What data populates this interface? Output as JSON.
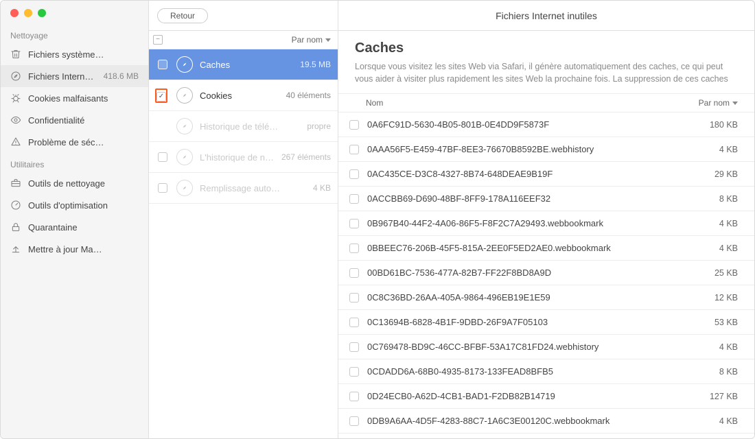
{
  "window_title": "Fichiers Internet inutiles",
  "toolbar": {
    "back_label": "Retour"
  },
  "sidebar": {
    "sections": [
      {
        "label": "Nettoyage",
        "items": [
          {
            "icon": "trash",
            "name": "fichiers-systeme",
            "label": "Fichiers système…",
            "meta": ""
          },
          {
            "icon": "compass",
            "name": "fichiers-internet",
            "label": "Fichiers Internet i…",
            "meta": "418.6 MB",
            "selected": true
          },
          {
            "icon": "bug",
            "name": "cookies-malfaisants",
            "label": "Cookies malfaisants",
            "meta": ""
          },
          {
            "icon": "eye",
            "name": "confidentialite",
            "label": "Confidentialité",
            "meta": ""
          },
          {
            "icon": "warning",
            "name": "probleme-securite",
            "label": "Problème de séc…",
            "meta": ""
          }
        ]
      },
      {
        "label": "Utilitaires",
        "items": [
          {
            "icon": "toolbox",
            "name": "outils-nettoyage",
            "label": "Outils de nettoyage",
            "meta": ""
          },
          {
            "icon": "gauge",
            "name": "outils-optimisation",
            "label": "Outils d'optimisation",
            "meta": ""
          },
          {
            "icon": "lock",
            "name": "quarantaine",
            "label": "Quarantaine",
            "meta": ""
          },
          {
            "icon": "upload",
            "name": "mettre-a-jour",
            "label": "Mettre à jour Ma…",
            "meta": ""
          }
        ]
      }
    ]
  },
  "mid": {
    "sort_label": "Par nom",
    "categories": [
      {
        "label": "Caches",
        "meta": "19.5 MB",
        "active": true,
        "checked": false,
        "faint": false,
        "highlight": false
      },
      {
        "label": "Cookies",
        "meta": "40 éléments",
        "active": false,
        "checked": true,
        "faint": false,
        "highlight": true
      },
      {
        "label": "Historique de télé…",
        "meta": "propre",
        "active": false,
        "checked": false,
        "faint": true,
        "highlight": false,
        "no_checkbox": true
      },
      {
        "label": "L'historique de na…",
        "meta": "267 éléments",
        "active": false,
        "checked": false,
        "faint": true,
        "highlight": false
      },
      {
        "label": "Remplissage auto…",
        "meta": "4 KB",
        "active": false,
        "checked": false,
        "faint": true,
        "highlight": false
      }
    ]
  },
  "detail": {
    "title": "Caches",
    "description": "Lorsque vous visitez les sites Web via Safari, il génère automatiquement des caches, ce qui peut vous aider à visiter plus rapidement les sites Web la prochaine fois. La suppression de ces caches peut vous…",
    "col_name": "Nom",
    "sort_label": "Par nom",
    "files": [
      {
        "name": "0A6FC91D-5630-4B05-801B-0E4DD9F5873F",
        "size": "180 KB"
      },
      {
        "name": "0AAA56F5-E459-47BF-8EE3-76670B8592BE.webhistory",
        "size": "4 KB"
      },
      {
        "name": "0AC435CE-D3C8-4327-8B74-648DEAE9B19F",
        "size": "29 KB"
      },
      {
        "name": "0ACCBB69-D690-48BF-8FF9-178A116EEF32",
        "size": "8 KB"
      },
      {
        "name": "0B967B40-44F2-4A06-86F5-F8F2C7A29493.webbookmark",
        "size": "4 KB"
      },
      {
        "name": "0BBEEC76-206B-45F5-815A-2EE0F5ED2AE0.webbookmark",
        "size": "4 KB"
      },
      {
        "name": "00BD61BC-7536-477A-82B7-FF22F8BD8A9D",
        "size": "25 KB"
      },
      {
        "name": "0C8C36BD-26AA-405A-9864-496EB19E1E59",
        "size": "12 KB"
      },
      {
        "name": "0C13694B-6828-4B1F-9DBD-26F9A7F05103",
        "size": "53 KB"
      },
      {
        "name": "0C769478-BD9C-46CC-BFBF-53A17C81FD24.webhistory",
        "size": "4 KB"
      },
      {
        "name": "0CDADD6A-68B0-4935-8173-133FEAD8BFB5",
        "size": "8 KB"
      },
      {
        "name": "0D24ECB0-A62D-4CB1-BAD1-F2DB82B14719",
        "size": "127 KB"
      },
      {
        "name": "0DB9A6AA-4D5F-4283-88C7-1A6C3E00120C.webbookmark",
        "size": "4 KB"
      }
    ]
  }
}
